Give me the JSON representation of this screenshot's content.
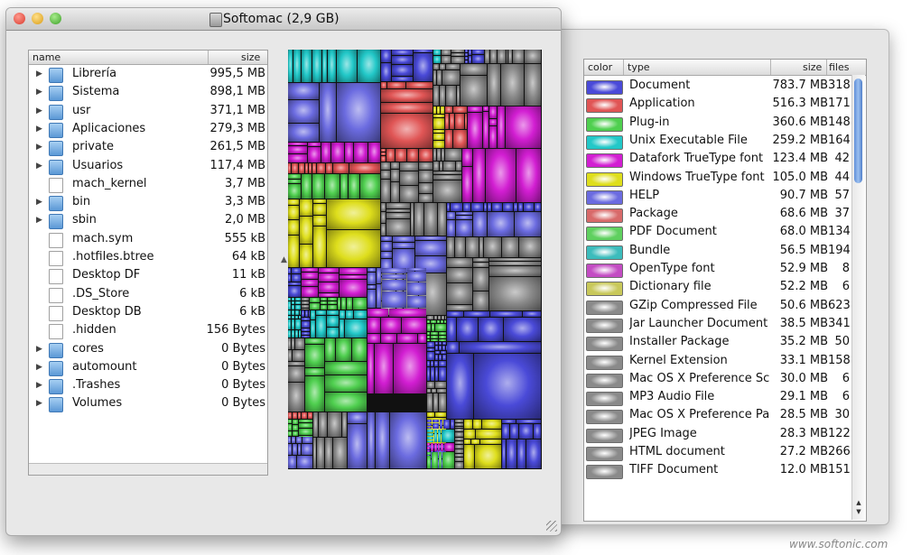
{
  "window": {
    "title": "Softomac (2,9 GB)"
  },
  "file_list": {
    "columns": {
      "name": "name",
      "size": "size"
    },
    "rows": [
      {
        "name": "Librería",
        "size": "995,5 MB",
        "kind": "folder",
        "expandable": true
      },
      {
        "name": "Sistema",
        "size": "898,1 MB",
        "kind": "folder",
        "expandable": true
      },
      {
        "name": "usr",
        "size": "371,1 MB",
        "kind": "folder",
        "expandable": true
      },
      {
        "name": "Aplicaciones",
        "size": "279,3 MB",
        "kind": "folder",
        "expandable": true
      },
      {
        "name": "private",
        "size": "261,5 MB",
        "kind": "folder",
        "expandable": true
      },
      {
        "name": "Usuarios",
        "size": "117,4 MB",
        "kind": "folder",
        "expandable": true
      },
      {
        "name": "mach_kernel",
        "size": "3,7 MB",
        "kind": "doc",
        "expandable": false
      },
      {
        "name": "bin",
        "size": "3,3 MB",
        "kind": "folder",
        "expandable": true
      },
      {
        "name": "sbin",
        "size": "2,0 MB",
        "kind": "folder",
        "expandable": true
      },
      {
        "name": "mach.sym",
        "size": "555 kB",
        "kind": "doc",
        "expandable": false
      },
      {
        "name": ".hotfiles.btree",
        "size": "64 kB",
        "kind": "doc",
        "expandable": false
      },
      {
        "name": "Desktop DF",
        "size": "11 kB",
        "kind": "doc",
        "expandable": false
      },
      {
        "name": ".DS_Store",
        "size": "6 kB",
        "kind": "doc",
        "expandable": false
      },
      {
        "name": "Desktop DB",
        "size": "6 kB",
        "kind": "doc",
        "expandable": false
      },
      {
        "name": ".hidden",
        "size": "156 Bytes",
        "kind": "doc",
        "expandable": false
      },
      {
        "name": "cores",
        "size": "0 Bytes",
        "kind": "folder",
        "expandable": true
      },
      {
        "name": "automount",
        "size": "0 Bytes",
        "kind": "folder",
        "expandable": true
      },
      {
        "name": ".Trashes",
        "size": "0 Bytes",
        "kind": "folder",
        "expandable": true
      },
      {
        "name": "Volumes",
        "size": "0 Bytes",
        "kind": "folder",
        "expandable": true
      }
    ]
  },
  "types_table": {
    "columns": {
      "color": "color",
      "type": "type",
      "size": "size",
      "files": "files"
    },
    "rows": [
      {
        "type": "Document",
        "size": "783.7 MB",
        "files": "318",
        "color": "#4a4ad8"
      },
      {
        "type": "Application",
        "size": "516.3 MB",
        "files": "171",
        "color": "#e05555"
      },
      {
        "type": "Plug-in",
        "size": "360.6 MB",
        "files": "148",
        "color": "#4fcf4f"
      },
      {
        "type": "Unix Executable File",
        "size": "259.2 MB",
        "files": "164",
        "color": "#22c8c8"
      },
      {
        "type": "Datafork TrueType font",
        "size": "123.4 MB",
        "files": "42",
        "color": "#d21ed2"
      },
      {
        "type": "Windows TrueType font",
        "size": "105.0 MB",
        "files": "44",
        "color": "#dede1c"
      },
      {
        "type": "HELP",
        "size": "90.7 MB",
        "files": "57",
        "color": "#6b6be0"
      },
      {
        "type": "Package",
        "size": "68.6 MB",
        "files": "37",
        "color": "#d86a6a"
      },
      {
        "type": "PDF Document",
        "size": "68.0 MB",
        "files": "134",
        "color": "#5fd05f"
      },
      {
        "type": "Bundle",
        "size": "56.5 MB",
        "files": "194",
        "color": "#3cbcbc"
      },
      {
        "type": "OpenType font",
        "size": "52.9 MB",
        "files": "8",
        "color": "#c34cc3"
      },
      {
        "type": "Dictionary file",
        "size": "52.2 MB",
        "files": "6",
        "color": "#c8c85a"
      },
      {
        "type": "GZip Compressed File",
        "size": "50.6 MB",
        "files": "623",
        "color": "#8a8a8a"
      },
      {
        "type": "Jar Launcher Document",
        "size": "38.5 MB",
        "files": "341",
        "color": "#8a8a8a"
      },
      {
        "type": "Installer Package",
        "size": "35.2 MB",
        "files": "50",
        "color": "#8a8a8a"
      },
      {
        "type": "Kernel Extension",
        "size": "33.1 MB",
        "files": "158",
        "color": "#8a8a8a"
      },
      {
        "type": "Mac OS X Preference Sc",
        "size": "30.0 MB",
        "files": "6",
        "color": "#8a8a8a"
      },
      {
        "type": "MP3 Audio File",
        "size": "29.1 MB",
        "files": "6",
        "color": "#8a8a8a"
      },
      {
        "type": "Mac OS X Preference Pa",
        "size": "28.5 MB",
        "files": "30",
        "color": "#8a8a8a"
      },
      {
        "type": "JPEG Image",
        "size": "28.3 MB",
        "files": "122",
        "color": "#8a8a8a"
      },
      {
        "type": "HTML document",
        "size": "27.2 MB",
        "files": "266",
        "color": "#8a8a8a"
      },
      {
        "type": "TIFF Document",
        "size": "12.0 MB",
        "files": "151",
        "color": "#8a8a8a"
      }
    ]
  },
  "watermark": "www.softonic.com"
}
